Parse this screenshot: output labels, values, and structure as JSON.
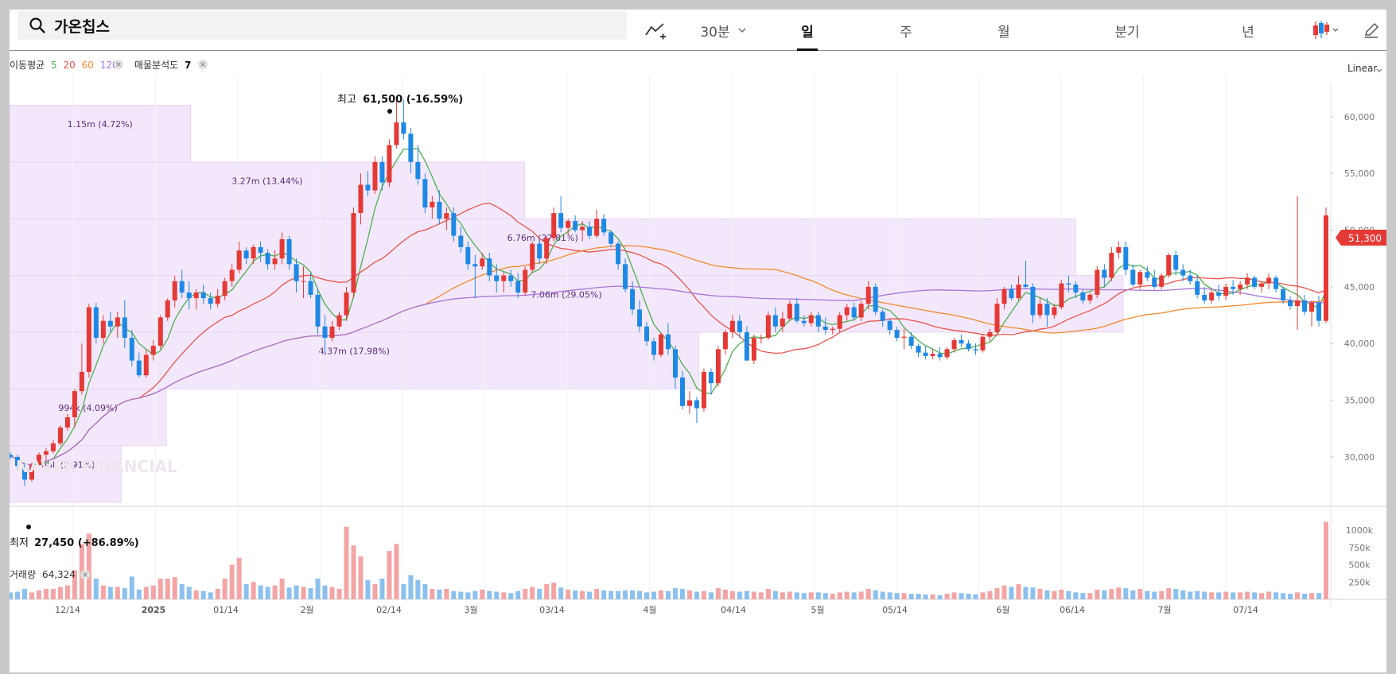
{
  "search": {
    "value": "가온칩스"
  },
  "toolbar": {
    "interval": "30분",
    "periods": [
      "일",
      "주",
      "월",
      "분기",
      "년"
    ],
    "active_period": "일"
  },
  "legend": {
    "ma_label": "이동평균",
    "ma_periods": [
      {
        "text": "5",
        "color": "#4caf50"
      },
      {
        "text": "20",
        "color": "#e5534b"
      },
      {
        "text": "60",
        "color": "#ef8a2b"
      },
      {
        "text": "120",
        "color": "#a875d6"
      }
    ],
    "vp_label": "매물분석도",
    "vp_value": "7",
    "volume_label": "거래량",
    "volume_value": "64,324"
  },
  "scale_mode": "Linear",
  "current_price": "51,300",
  "annotations": {
    "high_label": "최고",
    "high_value": "61,500 (-16.59%)",
    "low_label": "최저",
    "low_value": "27,450 (+86.89%)"
  },
  "watermark": "NAVER FINANCIAL",
  "colors": {
    "up": "#e53935",
    "down": "#1e88e5",
    "vol_up": "#f4a4a4",
    "vol_down": "#8cc0ef",
    "vp_fill": "#f3e8fb"
  },
  "chart_data": {
    "type": "candlestick",
    "price_axis": {
      "ticks": [
        "60,000",
        "55,000",
        "50,000",
        "45,000",
        "40,000",
        "35,000",
        "30,000"
      ],
      "ylim": [
        26000,
        63000
      ]
    },
    "volume_axis": {
      "ticks": [
        "1000k",
        "750k",
        "500k",
        "250k"
      ],
      "ylim": [
        0,
        1150000
      ]
    },
    "x_labels": [
      "12/14",
      "2025",
      "01/14",
      "2월",
      "02/14",
      "3월",
      "03/14",
      "4월",
      "04/14",
      "5월",
      "05/14",
      "6월",
      "06/14",
      "7월",
      "07/14"
    ],
    "volume_profile": [
      {
        "low": 26000,
        "high": 31000,
        "label": "708k (2.91%)"
      },
      {
        "low": 31000,
        "high": 36000,
        "label": "994k (4.09%)"
      },
      {
        "low": 36000,
        "high": 41000,
        "label": "4.37m (17.98%)"
      },
      {
        "low": 41000,
        "high": 46000,
        "label": "7.06m (29.05%)"
      },
      {
        "low": 46000,
        "high": 51000,
        "label": "6.76m (27.81%)"
      },
      {
        "low": 51000,
        "high": 56000,
        "label": "3.27m (13.44%)"
      },
      {
        "low": 56000,
        "high": 61000,
        "label": "1.15m (4.72%)"
      }
    ],
    "candles": [
      [
        30500,
        30800,
        30000,
        30200,
        120000
      ],
      [
        30200,
        30400,
        29800,
        30000,
        100000
      ],
      [
        30000,
        30200,
        28800,
        29200,
        110000
      ],
      [
        29200,
        29500,
        27450,
        28000,
        150000
      ],
      [
        28000,
        29500,
        27800,
        29300,
        100000
      ],
      [
        29300,
        30400,
        29100,
        30200,
        130000
      ],
      [
        30200,
        30800,
        29700,
        30500,
        150000
      ],
      [
        30500,
        31500,
        30300,
        31200,
        150000
      ],
      [
        31200,
        32800,
        31000,
        32600,
        180000
      ],
      [
        32600,
        33800,
        32300,
        33500,
        200000
      ],
      [
        33500,
        36000,
        32600,
        35800,
        420000
      ],
      [
        35800,
        40000,
        35500,
        37500,
        800000
      ],
      [
        37500,
        43500,
        37000,
        43200,
        950000
      ],
      [
        43200,
        43600,
        40000,
        40500,
        300000
      ],
      [
        40500,
        42500,
        40000,
        42000,
        200000
      ],
      [
        42000,
        42800,
        41000,
        41500,
        180000
      ],
      [
        41500,
        42800,
        40500,
        42300,
        180000
      ],
      [
        42300,
        43800,
        39600,
        40500,
        160000
      ],
      [
        40500,
        41200,
        38000,
        38500,
        330000
      ],
      [
        38500,
        39200,
        37000,
        37200,
        140000
      ],
      [
        37200,
        39500,
        37000,
        39000,
        180000
      ],
      [
        39000,
        40300,
        38500,
        39800,
        200000
      ],
      [
        39800,
        42500,
        39500,
        42300,
        300000
      ],
      [
        42300,
        44000,
        42000,
        43800,
        300000
      ],
      [
        43800,
        46000,
        43200,
        45500,
        320000
      ],
      [
        45500,
        46500,
        44000,
        44500,
        220000
      ],
      [
        44500,
        45500,
        43000,
        44000,
        180000
      ],
      [
        44000,
        44800,
        43000,
        44500,
        130000
      ],
      [
        44500,
        45200,
        43500,
        44000,
        120000
      ],
      [
        44000,
        44500,
        43000,
        43500,
        100000
      ],
      [
        43500,
        44800,
        43200,
        44200,
        150000
      ],
      [
        44200,
        45800,
        43800,
        45500,
        300000
      ],
      [
        45500,
        47000,
        45000,
        46500,
        500000
      ],
      [
        46500,
        49000,
        46200,
        48200,
        600000
      ],
      [
        48200,
        48500,
        47000,
        47500,
        220000
      ],
      [
        47500,
        48700,
        47000,
        48500,
        250000
      ],
      [
        48500,
        49000,
        47200,
        48000,
        200000
      ],
      [
        48000,
        48300,
        46500,
        47000,
        180000
      ],
      [
        47000,
        48200,
        46500,
        47500,
        200000
      ],
      [
        47500,
        49800,
        47000,
        49200,
        300000
      ],
      [
        49200,
        49500,
        46500,
        47000,
        170000
      ],
      [
        47000,
        47500,
        44500,
        45500,
        200000
      ],
      [
        45500,
        46800,
        44000,
        45500,
        180000
      ],
      [
        45500,
        46200,
        44000,
        44300,
        160000
      ],
      [
        44300,
        44800,
        40800,
        41500,
        300000
      ],
      [
        41500,
        42500,
        39000,
        40500,
        200000
      ],
      [
        40500,
        42000,
        40200,
        41500,
        180000
      ],
      [
        41500,
        42800,
        41200,
        42500,
        150000
      ],
      [
        42500,
        45000,
        42000,
        44500,
        1050000
      ],
      [
        44500,
        52000,
        44000,
        51500,
        780000
      ],
      [
        51500,
        55000,
        50500,
        54000,
        620000
      ],
      [
        54000,
        55200,
        53000,
        53500,
        280000
      ],
      [
        53500,
        56500,
        53200,
        56000,
        220000
      ],
      [
        56000,
        56500,
        53500,
        54200,
        300000
      ],
      [
        54200,
        58000,
        53800,
        57500,
        700000
      ],
      [
        57500,
        61500,
        57200,
        59500,
        800000
      ],
      [
        59500,
        61500,
        58000,
        58500,
        220000
      ],
      [
        58500,
        59000,
        55000,
        56000,
        350000
      ],
      [
        56000,
        57500,
        54000,
        54500,
        280000
      ],
      [
        54500,
        55000,
        51500,
        52000,
        220000
      ],
      [
        52000,
        53000,
        51000,
        52500,
        150000
      ],
      [
        52500,
        53500,
        50500,
        51000,
        140000
      ],
      [
        51000,
        52000,
        50000,
        51500,
        150000
      ],
      [
        51500,
        52000,
        49000,
        49500,
        120000
      ],
      [
        49500,
        50300,
        48000,
        48500,
        110000
      ],
      [
        48500,
        49000,
        46500,
        47000,
        100000
      ],
      [
        47000,
        47800,
        44000,
        46800,
        120000
      ],
      [
        46800,
        48000,
        46500,
        47500,
        140000
      ],
      [
        47500,
        48000,
        45500,
        46000,
        120000
      ],
      [
        46000,
        47000,
        44500,
        45500,
        110000
      ],
      [
        45500,
        46300,
        44500,
        46000,
        100000
      ],
      [
        46000,
        46500,
        45000,
        45500,
        90000
      ],
      [
        45500,
        46200,
        44000,
        44500,
        120000
      ],
      [
        44500,
        46800,
        44200,
        46500,
        150000
      ],
      [
        46500,
        49000,
        46200,
        48800,
        180000
      ],
      [
        48800,
        49200,
        47000,
        47500,
        150000
      ],
      [
        47500,
        49500,
        47000,
        49300,
        220000
      ],
      [
        49300,
        52000,
        49000,
        51500,
        240000
      ],
      [
        51500,
        53000,
        49800,
        50200,
        170000
      ],
      [
        50200,
        51000,
        49500,
        50800,
        140000
      ],
      [
        50800,
        51300,
        49800,
        50000,
        130000
      ],
      [
        50000,
        50800,
        49000,
        50300,
        120000
      ],
      [
        50300,
        50800,
        49200,
        49500,
        110000
      ],
      [
        49500,
        51800,
        49300,
        51000,
        150000
      ],
      [
        51000,
        51400,
        49500,
        49800,
        130000
      ],
      [
        49800,
        50000,
        48500,
        48800,
        120000
      ],
      [
        48800,
        49000,
        46500,
        47000,
        120000
      ],
      [
        47000,
        47500,
        44500,
        44800,
        130000
      ],
      [
        44800,
        45500,
        42500,
        43000,
        130000
      ],
      [
        43000,
        43800,
        41000,
        41500,
        120000
      ],
      [
        41500,
        41900,
        39800,
        40200,
        100000
      ],
      [
        40200,
        40500,
        38500,
        39000,
        110000
      ],
      [
        39000,
        41000,
        38800,
        40800,
        130000
      ],
      [
        40800,
        41800,
        39000,
        39500,
        120000
      ],
      [
        39500,
        39800,
        36000,
        37000,
        160000
      ],
      [
        37000,
        37600,
        34200,
        34500,
        150000
      ],
      [
        34500,
        35800,
        33800,
        35000,
        130000
      ],
      [
        35000,
        35300,
        33000,
        34300,
        110000
      ],
      [
        34300,
        37800,
        34000,
        37500,
        120000
      ],
      [
        37500,
        37800,
        35500,
        36500,
        100000
      ],
      [
        36500,
        39800,
        36200,
        39500,
        160000
      ],
      [
        39500,
        41200,
        39000,
        41000,
        140000
      ],
      [
        41000,
        42500,
        40500,
        42000,
        120000
      ],
      [
        42000,
        42500,
        40500,
        41000,
        110000
      ],
      [
        41000,
        41500,
        38500,
        38500,
        120000
      ],
      [
        38500,
        40800,
        38200,
        40500,
        110000
      ],
      [
        40500,
        40800,
        40000,
        40500,
        100000
      ],
      [
        40500,
        42800,
        40300,
        42500,
        150000
      ],
      [
        42500,
        43200,
        41000,
        41500,
        120000
      ],
      [
        41500,
        42800,
        41000,
        42200,
        100000
      ],
      [
        42200,
        43800,
        42000,
        43500,
        110000
      ],
      [
        43500,
        44000,
        41800,
        42000,
        100000
      ],
      [
        42000,
        42500,
        41500,
        41800,
        90000
      ],
      [
        41800,
        42800,
        41500,
        42500,
        100000
      ],
      [
        42500,
        42800,
        41000,
        41500,
        100000
      ],
      [
        41500,
        42300,
        40800,
        41200,
        90000
      ],
      [
        41200,
        41500,
        40800,
        41300,
        80000
      ],
      [
        41300,
        42800,
        41000,
        42500,
        100000
      ],
      [
        42500,
        43500,
        42000,
        43200,
        110000
      ],
      [
        43200,
        43600,
        42000,
        42300,
        100000
      ],
      [
        42300,
        43800,
        42000,
        43500,
        110000
      ],
      [
        43500,
        45500,
        43000,
        45000,
        150000
      ],
      [
        45000,
        45300,
        42500,
        42800,
        130000
      ],
      [
        42800,
        43000,
        41500,
        42000,
        110000
      ],
      [
        42000,
        42200,
        40800,
        41200,
        100000
      ],
      [
        41200,
        41500,
        40200,
        40500,
        90000
      ],
      [
        40500,
        41300,
        39500,
        40600,
        90000
      ],
      [
        40600,
        41000,
        39500,
        39800,
        80000
      ],
      [
        39800,
        40000,
        38800,
        39200,
        80000
      ],
      [
        39200,
        39800,
        38600,
        38900,
        70000
      ],
      [
        38900,
        39500,
        38600,
        39100,
        70000
      ],
      [
        39100,
        39700,
        38500,
        38800,
        60000
      ],
      [
        38800,
        39700,
        38600,
        39500,
        80000
      ],
      [
        39500,
        40500,
        39200,
        40300,
        100000
      ],
      [
        40300,
        40800,
        39700,
        40000,
        90000
      ],
      [
        40000,
        40300,
        39300,
        39500,
        80000
      ],
      [
        39500,
        40000,
        39000,
        39400,
        70000
      ],
      [
        39400,
        40800,
        39200,
        40600,
        100000
      ],
      [
        40600,
        41300,
        40200,
        41000,
        120000
      ],
      [
        41000,
        44000,
        40800,
        43500,
        160000
      ],
      [
        43500,
        45000,
        43000,
        44800,
        200000
      ],
      [
        44800,
        45200,
        43800,
        44000,
        180000
      ],
      [
        44000,
        46000,
        43800,
        45200,
        220000
      ],
      [
        45200,
        47300,
        44800,
        45000,
        180000
      ],
      [
        45000,
        45300,
        41800,
        42500,
        170000
      ],
      [
        42500,
        44000,
        42200,
        43500,
        150000
      ],
      [
        43500,
        44000,
        41500,
        42500,
        130000
      ],
      [
        42500,
        43500,
        42200,
        43200,
        120000
      ],
      [
        43200,
        45600,
        43000,
        45300,
        140000
      ],
      [
        45300,
        46000,
        44500,
        45200,
        120000
      ],
      [
        45200,
        45500,
        44000,
        44500,
        100000
      ],
      [
        44500,
        44800,
        43500,
        43800,
        90000
      ],
      [
        43800,
        44500,
        43500,
        44300,
        90000
      ],
      [
        44300,
        46800,
        44000,
        46500,
        140000
      ],
      [
        46500,
        47000,
        45000,
        45800,
        130000
      ],
      [
        45800,
        48500,
        45500,
        48000,
        150000
      ],
      [
        48000,
        49000,
        47500,
        48500,
        170000
      ],
      [
        48500,
        49000,
        46000,
        46500,
        160000
      ],
      [
        46500,
        47000,
        45000,
        45200,
        130000
      ],
      [
        45200,
        46500,
        44800,
        46300,
        150000
      ],
      [
        46300,
        46800,
        45500,
        45800,
        120000
      ],
      [
        45800,
        46500,
        44800,
        45000,
        110000
      ],
      [
        45000,
        46200,
        44800,
        46000,
        120000
      ],
      [
        46000,
        48000,
        45800,
        47800,
        160000
      ],
      [
        47800,
        48200,
        46000,
        46500,
        150000
      ],
      [
        46500,
        47000,
        45500,
        46000,
        130000
      ],
      [
        46000,
        46500,
        45200,
        45500,
        110000
      ],
      [
        45500,
        46000,
        44000,
        44300,
        120000
      ],
      [
        44300,
        45000,
        43500,
        43800,
        110000
      ],
      [
        43800,
        44800,
        43500,
        44500,
        100000
      ],
      [
        44500,
        45200,
        43800,
        44200,
        100000
      ],
      [
        44200,
        45300,
        43800,
        45000,
        110000
      ],
      [
        45000,
        45600,
        44300,
        44800,
        100000
      ],
      [
        44800,
        45500,
        44300,
        45200,
        100000
      ],
      [
        45200,
        46200,
        44800,
        45800,
        110000
      ],
      [
        45800,
        46000,
        44800,
        45000,
        100000
      ],
      [
        45000,
        45500,
        44500,
        45300,
        90000
      ],
      [
        45300,
        46200,
        44800,
        45800,
        110000
      ],
      [
        45800,
        46000,
        44500,
        44800,
        100000
      ],
      [
        44800,
        45000,
        43500,
        43800,
        90000
      ],
      [
        43800,
        44200,
        43000,
        43300,
        80000
      ],
      [
        43300,
        53000,
        41200,
        43800,
        100000
      ],
      [
        43800,
        44300,
        42500,
        42800,
        80000
      ],
      [
        42800,
        43800,
        41500,
        43600,
        90000
      ],
      [
        43600,
        44200,
        41500,
        42000,
        90000
      ],
      [
        42000,
        52000,
        41800,
        51300,
        1120000
      ]
    ]
  }
}
